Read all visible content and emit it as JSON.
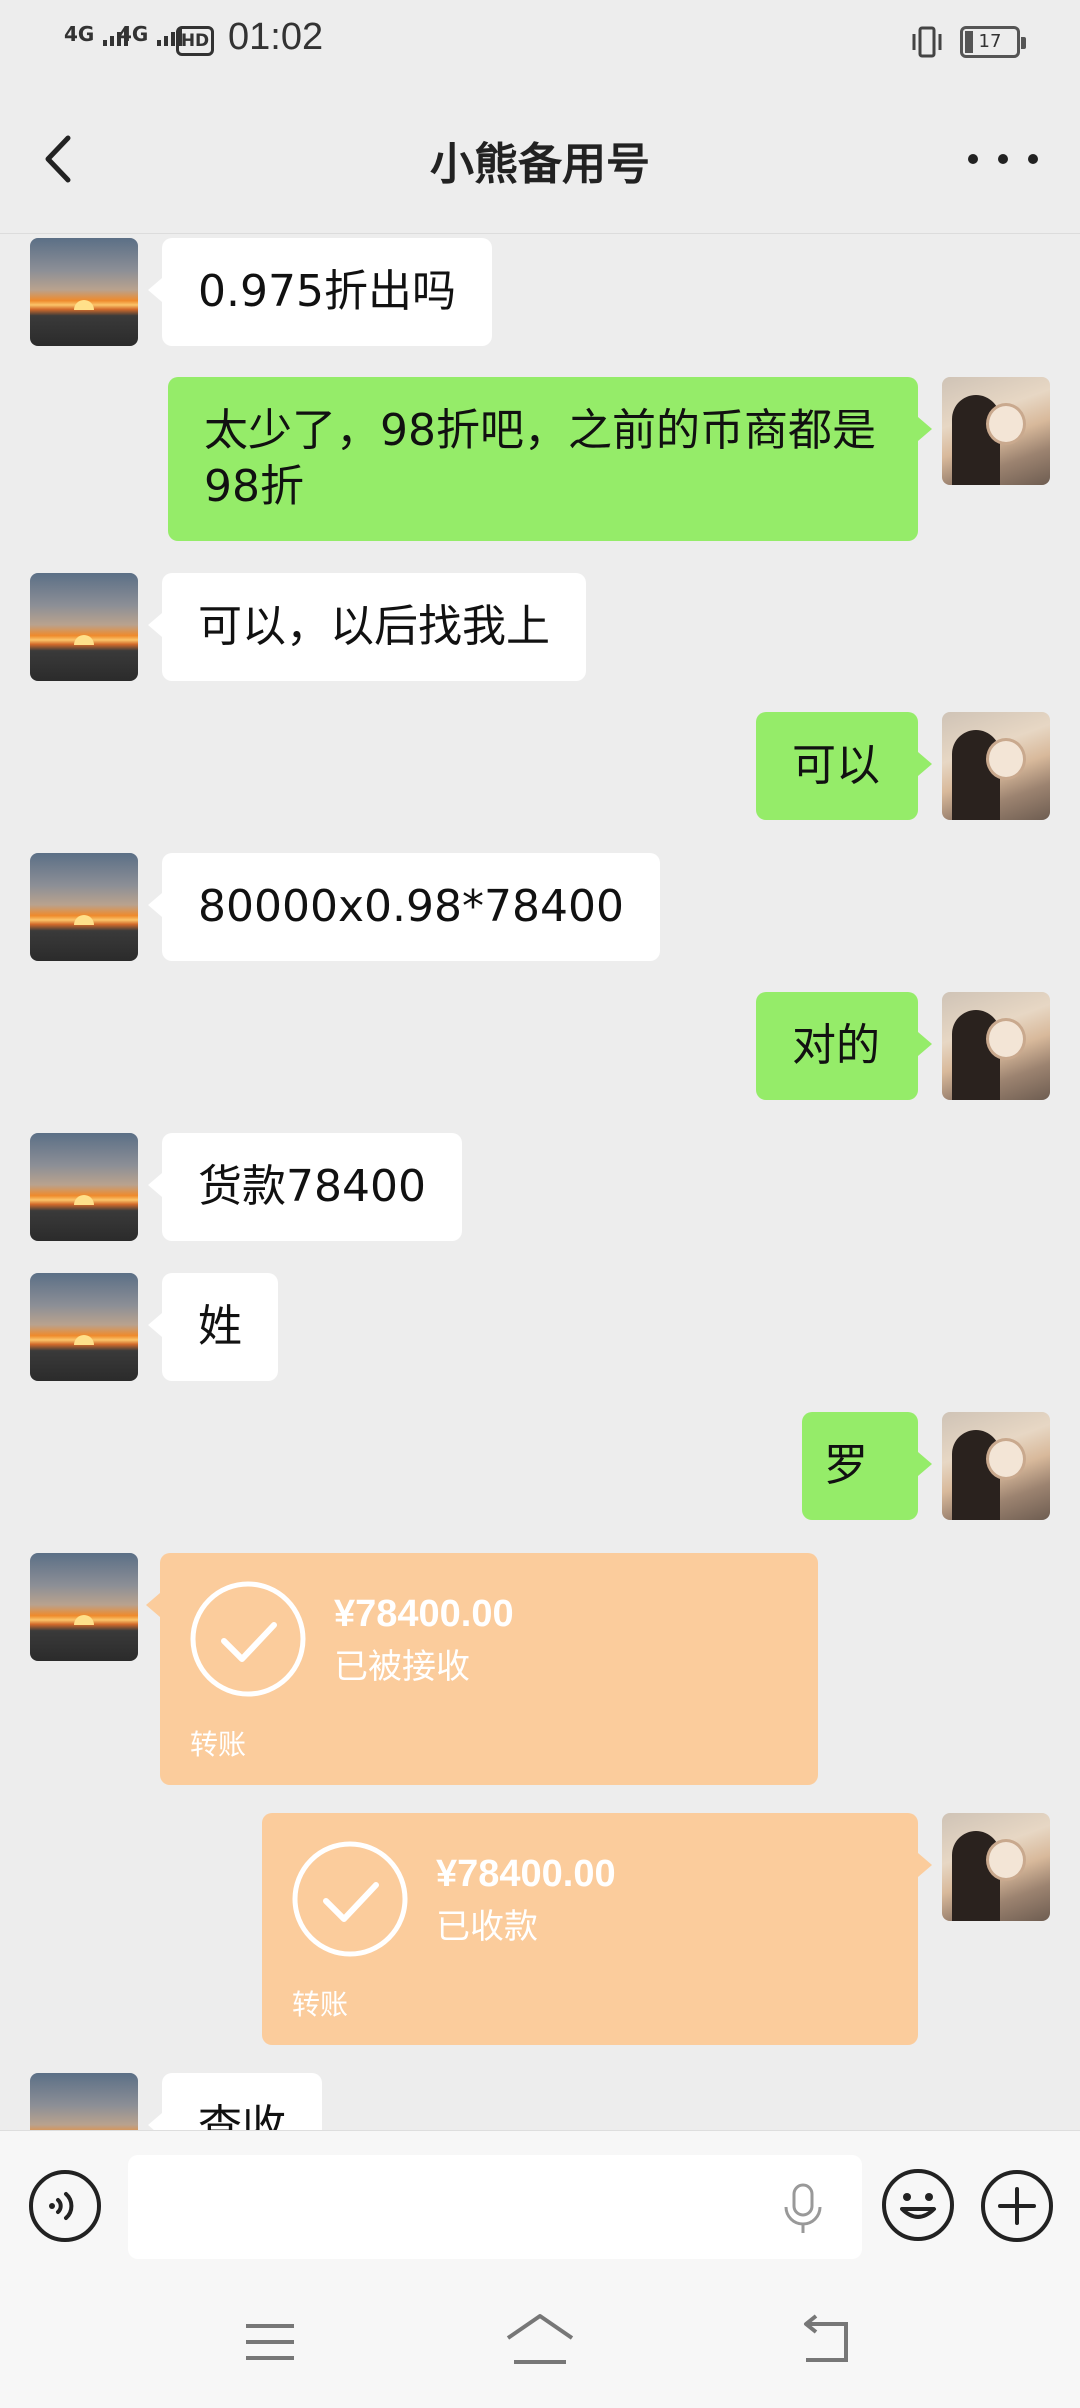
{
  "status_bar": {
    "signal1": "4G",
    "signal2": "4G",
    "hd": "HD",
    "time": "01:02",
    "battery": "17"
  },
  "header": {
    "title": "小熊备用号"
  },
  "messages": [
    {
      "side": "in",
      "text": "0.975折出吗"
    },
    {
      "side": "out",
      "text": "太少了，98折吧，之前的币商都是98折"
    },
    {
      "side": "in",
      "text": "可以，以后找我上"
    },
    {
      "side": "out",
      "text": "可以"
    },
    {
      "side": "in",
      "text": "80000x0.98*78400"
    },
    {
      "side": "out",
      "text": "对的"
    },
    {
      "side": "in",
      "text": "货款78400"
    },
    {
      "side": "in",
      "text": "姓"
    },
    {
      "side": "out",
      "text": "罗"
    },
    {
      "side": "in",
      "type": "transfer",
      "amount": "¥78400.00",
      "status": "已被接收",
      "label": "转账"
    },
    {
      "side": "out",
      "type": "transfer",
      "amount": "¥78400.00",
      "status": "已收款",
      "label": "转账"
    },
    {
      "side": "in",
      "text": "查收"
    }
  ],
  "colors": {
    "out_bubble": "#95ec69",
    "in_bubble": "#ffffff",
    "transfer": "#fbcc9c",
    "background": "#ededed"
  },
  "icons": [
    "back-arrow-icon",
    "more-icon",
    "voice-icon",
    "mic-icon",
    "emoji-icon",
    "plus-icon",
    "menu-icon",
    "home-icon",
    "back-nav-icon"
  ]
}
